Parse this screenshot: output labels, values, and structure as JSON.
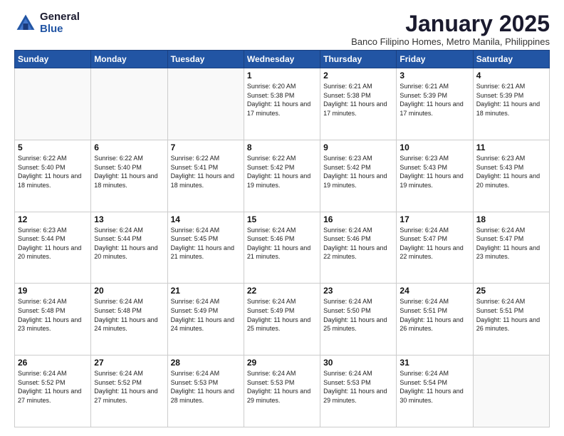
{
  "logo": {
    "general": "General",
    "blue": "Blue"
  },
  "header": {
    "month": "January 2025",
    "location": "Banco Filipino Homes, Metro Manila, Philippines"
  },
  "weekdays": [
    "Sunday",
    "Monday",
    "Tuesday",
    "Wednesday",
    "Thursday",
    "Friday",
    "Saturday"
  ],
  "weeks": [
    [
      {
        "day": "",
        "info": ""
      },
      {
        "day": "",
        "info": ""
      },
      {
        "day": "",
        "info": ""
      },
      {
        "day": "1",
        "info": "Sunrise: 6:20 AM\nSunset: 5:38 PM\nDaylight: 11 hours and 17 minutes."
      },
      {
        "day": "2",
        "info": "Sunrise: 6:21 AM\nSunset: 5:38 PM\nDaylight: 11 hours and 17 minutes."
      },
      {
        "day": "3",
        "info": "Sunrise: 6:21 AM\nSunset: 5:39 PM\nDaylight: 11 hours and 17 minutes."
      },
      {
        "day": "4",
        "info": "Sunrise: 6:21 AM\nSunset: 5:39 PM\nDaylight: 11 hours and 18 minutes."
      }
    ],
    [
      {
        "day": "5",
        "info": "Sunrise: 6:22 AM\nSunset: 5:40 PM\nDaylight: 11 hours and 18 minutes."
      },
      {
        "day": "6",
        "info": "Sunrise: 6:22 AM\nSunset: 5:40 PM\nDaylight: 11 hours and 18 minutes."
      },
      {
        "day": "7",
        "info": "Sunrise: 6:22 AM\nSunset: 5:41 PM\nDaylight: 11 hours and 18 minutes."
      },
      {
        "day": "8",
        "info": "Sunrise: 6:22 AM\nSunset: 5:42 PM\nDaylight: 11 hours and 19 minutes."
      },
      {
        "day": "9",
        "info": "Sunrise: 6:23 AM\nSunset: 5:42 PM\nDaylight: 11 hours and 19 minutes."
      },
      {
        "day": "10",
        "info": "Sunrise: 6:23 AM\nSunset: 5:43 PM\nDaylight: 11 hours and 19 minutes."
      },
      {
        "day": "11",
        "info": "Sunrise: 6:23 AM\nSunset: 5:43 PM\nDaylight: 11 hours and 20 minutes."
      }
    ],
    [
      {
        "day": "12",
        "info": "Sunrise: 6:23 AM\nSunset: 5:44 PM\nDaylight: 11 hours and 20 minutes."
      },
      {
        "day": "13",
        "info": "Sunrise: 6:24 AM\nSunset: 5:44 PM\nDaylight: 11 hours and 20 minutes."
      },
      {
        "day": "14",
        "info": "Sunrise: 6:24 AM\nSunset: 5:45 PM\nDaylight: 11 hours and 21 minutes."
      },
      {
        "day": "15",
        "info": "Sunrise: 6:24 AM\nSunset: 5:46 PM\nDaylight: 11 hours and 21 minutes."
      },
      {
        "day": "16",
        "info": "Sunrise: 6:24 AM\nSunset: 5:46 PM\nDaylight: 11 hours and 22 minutes."
      },
      {
        "day": "17",
        "info": "Sunrise: 6:24 AM\nSunset: 5:47 PM\nDaylight: 11 hours and 22 minutes."
      },
      {
        "day": "18",
        "info": "Sunrise: 6:24 AM\nSunset: 5:47 PM\nDaylight: 11 hours and 23 minutes."
      }
    ],
    [
      {
        "day": "19",
        "info": "Sunrise: 6:24 AM\nSunset: 5:48 PM\nDaylight: 11 hours and 23 minutes."
      },
      {
        "day": "20",
        "info": "Sunrise: 6:24 AM\nSunset: 5:48 PM\nDaylight: 11 hours and 24 minutes."
      },
      {
        "day": "21",
        "info": "Sunrise: 6:24 AM\nSunset: 5:49 PM\nDaylight: 11 hours and 24 minutes."
      },
      {
        "day": "22",
        "info": "Sunrise: 6:24 AM\nSunset: 5:49 PM\nDaylight: 11 hours and 25 minutes."
      },
      {
        "day": "23",
        "info": "Sunrise: 6:24 AM\nSunset: 5:50 PM\nDaylight: 11 hours and 25 minutes."
      },
      {
        "day": "24",
        "info": "Sunrise: 6:24 AM\nSunset: 5:51 PM\nDaylight: 11 hours and 26 minutes."
      },
      {
        "day": "25",
        "info": "Sunrise: 6:24 AM\nSunset: 5:51 PM\nDaylight: 11 hours and 26 minutes."
      }
    ],
    [
      {
        "day": "26",
        "info": "Sunrise: 6:24 AM\nSunset: 5:52 PM\nDaylight: 11 hours and 27 minutes."
      },
      {
        "day": "27",
        "info": "Sunrise: 6:24 AM\nSunset: 5:52 PM\nDaylight: 11 hours and 27 minutes."
      },
      {
        "day": "28",
        "info": "Sunrise: 6:24 AM\nSunset: 5:53 PM\nDaylight: 11 hours and 28 minutes."
      },
      {
        "day": "29",
        "info": "Sunrise: 6:24 AM\nSunset: 5:53 PM\nDaylight: 11 hours and 29 minutes."
      },
      {
        "day": "30",
        "info": "Sunrise: 6:24 AM\nSunset: 5:53 PM\nDaylight: 11 hours and 29 minutes."
      },
      {
        "day": "31",
        "info": "Sunrise: 6:24 AM\nSunset: 5:54 PM\nDaylight: 11 hours and 30 minutes."
      },
      {
        "day": "",
        "info": ""
      }
    ]
  ]
}
